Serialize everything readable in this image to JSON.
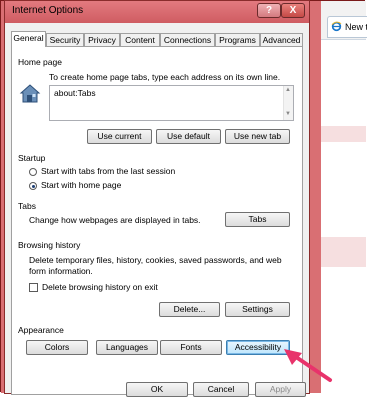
{
  "dialog": {
    "title": "Internet Options",
    "help_label": "?",
    "close_label": "X"
  },
  "tabs": [
    {
      "label": "General"
    },
    {
      "label": "Security"
    },
    {
      "label": "Privacy"
    },
    {
      "label": "Content"
    },
    {
      "label": "Connections"
    },
    {
      "label": "Programs"
    },
    {
      "label": "Advanced"
    }
  ],
  "home_page": {
    "group_label": "Home page",
    "description": "To create home page tabs, type each address on its own line.",
    "value": "about:Tabs",
    "use_current": "Use current",
    "use_default": "Use default",
    "use_new_tab": "Use new tab"
  },
  "startup": {
    "group_label": "Startup",
    "option_last_session": "Start with tabs from the last session",
    "option_home_page": "Start with home page"
  },
  "tabs_group": {
    "group_label": "Tabs",
    "description": "Change how webpages are displayed in tabs.",
    "button": "Tabs"
  },
  "browsing_history": {
    "group_label": "Browsing history",
    "description_line1": "Delete temporary files, history, cookies, saved passwords, and web",
    "description_line2": "form information.",
    "delete_on_exit": "Delete browsing history on exit",
    "delete_button": "Delete...",
    "settings_button": "Settings"
  },
  "appearance": {
    "group_label": "Appearance",
    "colors": "Colors",
    "languages": "Languages",
    "fonts": "Fonts",
    "accessibility": "Accessibility"
  },
  "footer": {
    "ok": "OK",
    "cancel": "Cancel",
    "apply": "Apply"
  },
  "browser_behind": {
    "tab_label": "New ta"
  },
  "colors": {
    "chrome_red": "#d96f73",
    "annotation_arrow": "#e8336b"
  }
}
